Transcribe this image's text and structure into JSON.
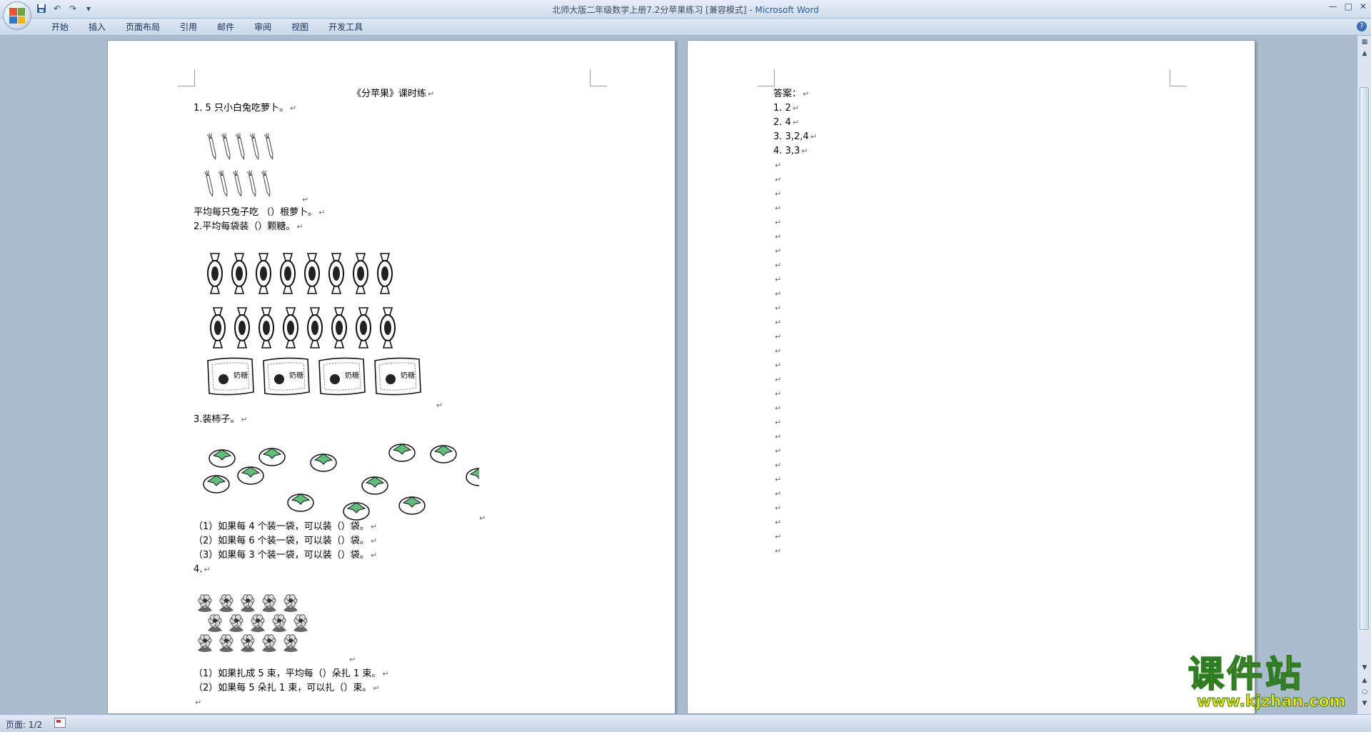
{
  "window": {
    "title": "北师大版二年级数学上册7.2分苹果练习 [兼容模式] - ",
    "app_name": "Microsoft Word",
    "controls": [
      "—",
      "□",
      "✕"
    ]
  },
  "quick_access": {
    "save_icon": "save-icon",
    "undo_icon": "undo-icon",
    "redo_icon": "redo-icon",
    "customize": "▾"
  },
  "ribbon": {
    "tabs": [
      "开始",
      "插入",
      "页面布局",
      "引用",
      "邮件",
      "审阅",
      "视图",
      "开发工具"
    ],
    "help": "?"
  },
  "page1": {
    "title": "《分苹果》课时练",
    "q1": "1. 5 只小白兔吃萝卜。",
    "q1_ask": "平均每只兔子吃 （）根萝卜。",
    "q2": "2.平均每袋装（）颗糖。",
    "q3": "3.装柿子。",
    "q3_1": "（1）如果每 4 个装一袋，可以装（）袋。",
    "q3_2": "（2）如果每 6 个装一袋，可以装（）袋。",
    "q3_3": "（3）如果每 3 个装一袋，可以装（）袋。",
    "q4": "4.",
    "q4_1": "（1）如果扎成 5 束，平均每（）朵扎 1 束。",
    "q4_2": "（2）如果每 5 朵扎 1 束，可以扎（）束。",
    "candy_label": "奶糖",
    "counts": {
      "carrots": 10,
      "candies": 16,
      "candy_bags": 4,
      "persimmons": 12,
      "flowers": 15
    }
  },
  "page2": {
    "heading": "答案：",
    "answers": [
      "1.   2",
      "2.   4",
      "3.   3,2,4",
      "4.   3,3"
    ],
    "empty_paragraphs": 28
  },
  "paragraph_mark": "↵",
  "statusbar": {
    "page": "页面: 1/2"
  },
  "watermark": {
    "title": "课件站",
    "url": "www.kjzhan.com"
  },
  "colors": {
    "persimmon_leaf": "#5fbf7a",
    "watermark_fill": "#ffe600",
    "watermark_stroke": "#2f7d23"
  }
}
